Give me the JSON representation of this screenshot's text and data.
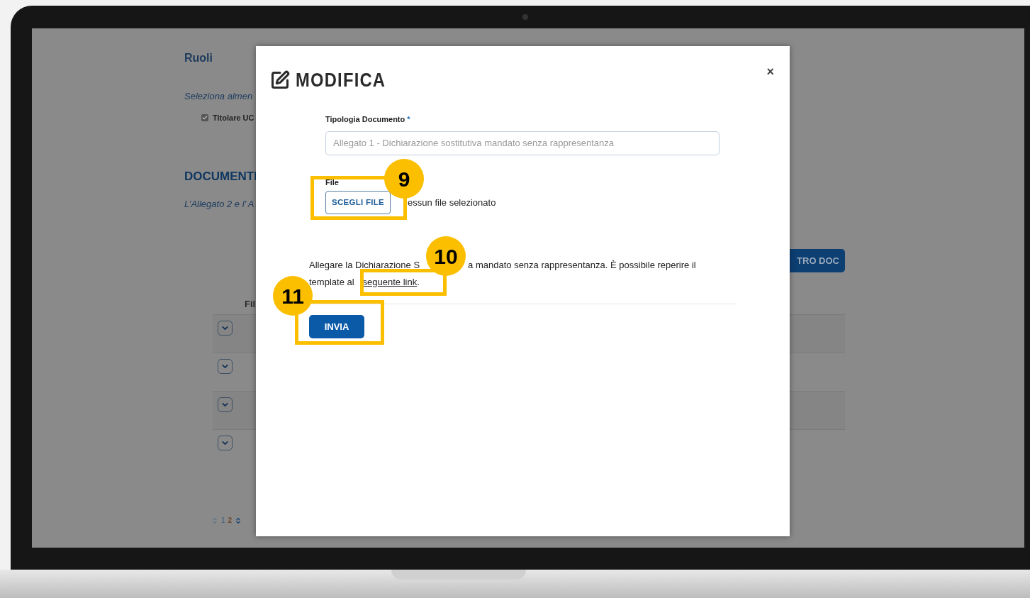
{
  "background_page": {
    "roles_heading": "Ruoli",
    "roles_hint": "Seleziona almen",
    "roles": [
      {
        "label": "Titolare UC",
        "checked": true
      }
    ],
    "documents_heading": "DOCUMENTI",
    "documents_hint": "L’Allegato 2 e l’ A",
    "add_button": "TRO DOC",
    "table": {
      "column_1": "Fil",
      "rows": [
        {
          "expanded": false
        },
        {
          "expanded": false
        },
        {
          "expanded": false
        },
        {
          "expanded": false
        }
      ]
    },
    "pagination": [
      {
        "label": "1",
        "selected": false
      },
      {
        "label": "2",
        "selected": true
      }
    ]
  },
  "modal": {
    "title": "MODIFICA",
    "close": "×",
    "fields": [
      {
        "label": "Tipologia Documento",
        "required": true,
        "required_mark": "*",
        "placeholder": "Allegato 1 - Dichiarazione sostitutiva mandato senza rappresentanza"
      }
    ],
    "file": {
      "label": "File",
      "button": "SCEGLI FILE",
      "status": "essun file selezionato"
    },
    "note": {
      "line_1_start": "Allegare la Dichiarazione S",
      "line_1_end": "a mandato senza rappresentanza. È possibile reperire il",
      "line_2_start": "template al",
      "link": "seguente link",
      "line_2_end": "."
    },
    "submit": "INVIA"
  },
  "annotations": [
    {
      "label": "9"
    },
    {
      "label": "10"
    },
    {
      "label": "11"
    }
  ]
}
